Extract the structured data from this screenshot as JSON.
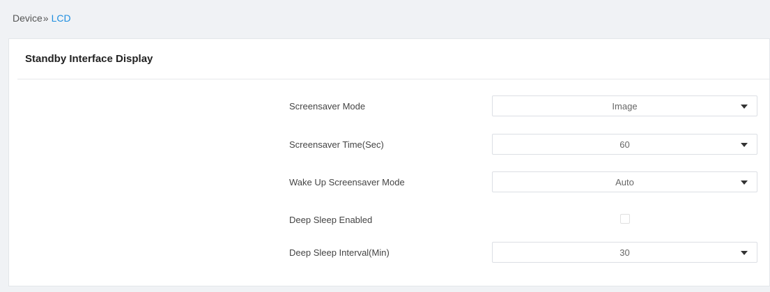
{
  "breadcrumb": {
    "parent": "Device",
    "separator": "»",
    "current": "LCD"
  },
  "panel": {
    "title": "Standby Interface Display"
  },
  "settings": {
    "screensaver_mode": {
      "label": "Screensaver Mode",
      "value": "Image"
    },
    "screensaver_time": {
      "label": "Screensaver Time(Sec)",
      "value": "60"
    },
    "wake_up_mode": {
      "label": "Wake Up Screensaver Mode",
      "value": "Auto"
    },
    "deep_sleep_enabled": {
      "label": "Deep Sleep Enabled",
      "checked": false
    },
    "deep_sleep_interval": {
      "label": "Deep Sleep Interval(Min)",
      "value": "30"
    }
  },
  "icons": {
    "dropdown": "chevron-down-icon"
  },
  "colors": {
    "accent": "#1f8fe0",
    "background": "#f0f2f5"
  }
}
